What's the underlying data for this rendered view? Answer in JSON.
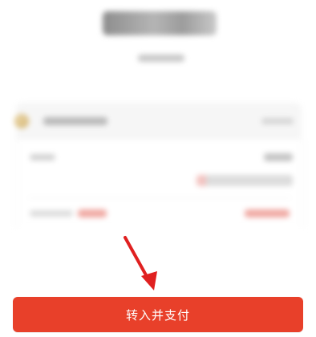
{
  "action": {
    "primary_label": "转入并支付"
  },
  "colors": {
    "primary": "#e8402a",
    "annotation_arrow": "#e02020"
  },
  "icons": {
    "bank": "bank-logo-icon",
    "pointer": "annotation-arrow-icon"
  }
}
